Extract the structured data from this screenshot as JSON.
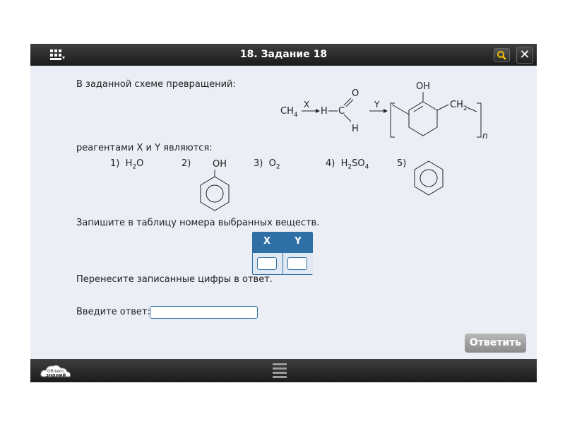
{
  "window": {
    "title": "18. Задание 18",
    "submit_label": "Ответить",
    "logo_text_line1": "Облако",
    "logo_text_line2": "знаний"
  },
  "task": {
    "intro": "В заданной схеме превращений:",
    "reagents_prompt": "реагентами X и Y являются:",
    "scheme": {
      "start": "CH",
      "start_sub": "4",
      "arrow1": "X",
      "arrow2": "Y",
      "aldehyde_h": "H",
      "aldehyde_c": "C",
      "aldehyde_o": "O",
      "aldehyde_h2": "H",
      "phenol_oh": "OH",
      "ch2": "CH",
      "ch2_sub": "2",
      "n": "n"
    },
    "options": [
      {
        "num": "1)",
        "main": "H",
        "sub": "2",
        "tail": "O"
      },
      {
        "num": "2)",
        "label": "OH"
      },
      {
        "num": "3)",
        "main": "O",
        "sub": "2",
        "tail": ""
      },
      {
        "num": "4)",
        "main": "H",
        "sub": "2",
        "tail": "SO",
        "sub2": "4"
      },
      {
        "num": "5)"
      }
    ],
    "table_instruction": "Запишите в таблицу номера выбранных веществ.",
    "table_headers": [
      "X",
      "Y"
    ],
    "transfer_instruction": "Перенесите записанные цифры в ответ.",
    "answer_label": "Введите ответ:"
  }
}
